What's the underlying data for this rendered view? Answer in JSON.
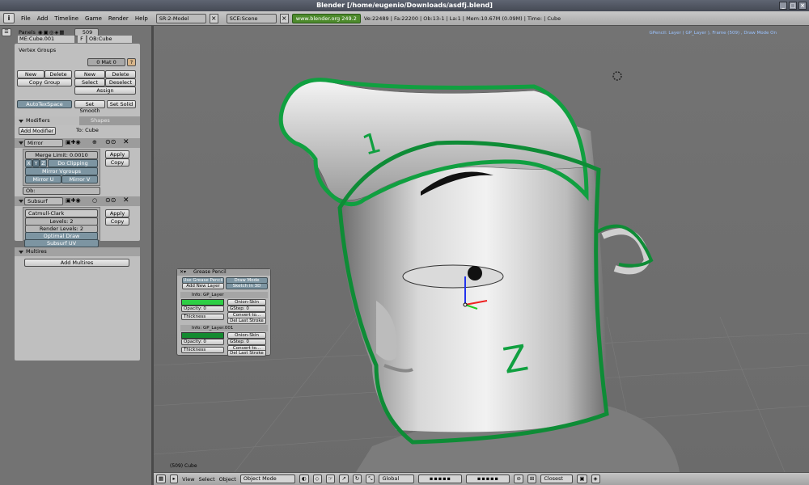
{
  "window": {
    "title": "Blender [/home/eugenio/Downloads/asdfj.blend]",
    "min": "_",
    "max": "□",
    "close": "×"
  },
  "menubar": {
    "items": [
      "File",
      "Add",
      "Timeline",
      "Game",
      "Render",
      "Help"
    ],
    "screen": "SR:2-Model",
    "scene": "SCE:Scene",
    "link": "www.blender.org 249.2",
    "stats": "Ve:22489 | Fa:22200 | Ob:13-1 | La:1  | Mem:10.67M (0.09M)  | Time: | Cube"
  },
  "panels": {
    "label": "Panels",
    "frame": "509",
    "mesh": "ME:Cube.001",
    "f": "F",
    "object": "OB:Cube"
  },
  "vertex_groups": {
    "title": "Vertex Groups",
    "mat": "0 Mat 0",
    "q": "?",
    "new": "New",
    "delete": "Delete",
    "copy_group": "Copy Group",
    "new2": "New",
    "delete2": "Delete",
    "select": "Select",
    "deselect": "Deselect",
    "assign": "Assign",
    "autotex": "AutoTexSpace",
    "set_smooth": "Set Smooth",
    "set_solid": "Set Solid"
  },
  "modifiers": {
    "tab1": "Modifiers",
    "tab2": "Shapes",
    "add": "Add Modifier",
    "to": "To: Cube",
    "mirror": {
      "name": "Mirror",
      "merge": "Merge Limit: 0.0010",
      "x": "X",
      "y": "Y",
      "z": "Z",
      "doclip": "Do Clipping",
      "vgroups": "Mirror Vgroups",
      "mu": "Mirror U",
      "mv": "Mirror V",
      "ob": "Ob:",
      "apply": "Apply",
      "copy": "Copy"
    },
    "subsurf": {
      "name": "Subsurf",
      "type": "Catmull-Clark",
      "levels": "Levels: 2",
      "render": "Render Levels: 2",
      "optimal": "Optimal Draw",
      "uv": "Subsurf UV",
      "apply": "Apply",
      "copy": "Copy"
    }
  },
  "multires": {
    "title": "Multires",
    "add": "Add Multires"
  },
  "grease": {
    "title": "Grease Pencil",
    "use": "Use Grease Pencil",
    "draw": "Draw Mode",
    "addlayer": "Add New Layer",
    "sketch": "Sketch in 3D",
    "layer1": {
      "name": "Info: GP_Layer",
      "onion": "Onion-Skin",
      "opacity": "Opacity: 0",
      "gstep": "GStep: 0",
      "thick": "Thickness",
      "convert": "Convert to...",
      "dellast": "Del Last Stroke",
      "color": "#2ecf45"
    },
    "layer2": {
      "name": "Info: GP_Layer.001",
      "onion": "Onion-Skin",
      "opacity": "Opacity: 0",
      "gstep": "GStep: 0",
      "thick": "Thickness",
      "convert": "Convert to...",
      "dellast": "Del Last Stroke",
      "color": "#148a30"
    }
  },
  "viewport": {
    "hint": "GPencil: Layer ( GP_Layer ), Frame (509) , Draw Mode On",
    "frame": "(509) Cube",
    "stroke_color": "#0c9a3a",
    "note1": "1",
    "note2": "Z"
  },
  "bottom": {
    "view": "View",
    "select": "Select",
    "object": "Object",
    "mode": "Object Mode",
    "orient": "Global",
    "snap": "Closest"
  }
}
